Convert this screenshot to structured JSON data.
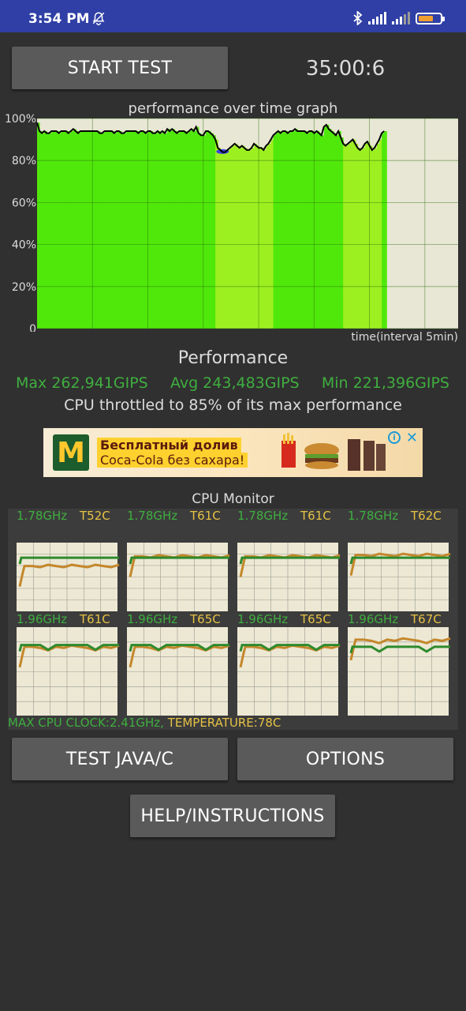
{
  "status": {
    "time": "3:54 PM",
    "battery_level": 0.7,
    "icons": [
      "bell-off-icon",
      "bluetooth-icon",
      "signal-icon",
      "signal-icon",
      "battery-icon"
    ]
  },
  "controls": {
    "start_label": "START TEST",
    "timer": "35:00:6"
  },
  "graph": {
    "title": "performance over time graph",
    "y_ticks": [
      "100%",
      "80%",
      "60%",
      "40%",
      "20%",
      "0"
    ],
    "time_label": "time(interval 5min)"
  },
  "chart_data": {
    "type": "area",
    "title": "performance over time graph",
    "xlabel": "time(interval 5min)",
    "ylabel": "",
    "ylim": [
      0,
      100
    ],
    "y_ticks": [
      "100%",
      "80%",
      "60%",
      "40%",
      "20%",
      "0"
    ],
    "elapsed_fraction": 0.83,
    "series": [
      {
        "values": [
          98,
          94,
          93,
          94,
          93,
          93,
          94,
          94,
          94,
          93,
          94,
          94,
          94,
          93,
          94,
          95,
          94,
          93,
          94,
          94,
          94,
          94,
          94,
          94,
          94,
          94,
          93,
          93,
          94,
          94,
          94,
          94,
          93,
          94,
          94,
          93,
          93,
          94,
          94,
          94,
          94,
          94,
          93,
          94,
          94,
          93,
          94,
          94,
          93,
          93,
          94,
          93,
          94,
          93,
          95,
          94,
          95,
          94,
          93,
          94,
          94,
          94,
          93,
          94,
          95,
          94,
          96,
          93,
          92,
          92,
          94,
          94,
          93,
          92,
          90,
          86,
          85,
          84,
          84,
          85,
          86,
          87,
          88,
          87,
          86,
          87,
          86,
          85,
          85,
          86,
          88,
          87,
          86,
          86,
          85,
          87,
          88,
          90,
          92,
          93,
          94,
          93,
          94,
          94,
          93,
          94,
          94,
          95,
          94,
          94,
          94,
          94,
          93,
          94,
          94,
          93,
          94,
          93,
          92,
          96,
          97,
          95,
          94,
          93,
          92,
          94,
          91,
          88,
          87,
          88,
          89,
          90,
          88,
          86,
          85,
          86,
          88,
          89,
          87,
          85,
          86,
          88,
          90,
          93,
          94
        ]
      }
    ],
    "colors": {
      "line": "#000000",
      "fill_high": "#50e80a",
      "fill_low": "#9df020",
      "dip_fill": "#3a44e0"
    }
  },
  "performance": {
    "title": "Performance",
    "max": "Max 262,941GIPS",
    "avg": "Avg 243,483GIPS",
    "min": "Min 221,396GIPS",
    "throttle_text": "CPU throttled to 85% of its max performance"
  },
  "ad": {
    "line1": "Бесплатный долив",
    "line2": "Coca-Cola без сахара!",
    "logo_icon": "mcdonalds-logo-icon"
  },
  "cpu_monitor": {
    "title": "CPU Monitor",
    "cores": [
      {
        "freq": "1.78GHz",
        "temp": "T52C",
        "freq_level": 0.78,
        "temp_level": 0.66
      },
      {
        "freq": "1.78GHz",
        "temp": "T61C",
        "freq_level": 0.78,
        "temp_level": 0.8
      },
      {
        "freq": "1.78GHz",
        "temp": "T61C",
        "freq_level": 0.78,
        "temp_level": 0.8
      },
      {
        "freq": "1.78GHz",
        "temp": "T62C",
        "freq_level": 0.78,
        "temp_level": 0.82
      },
      {
        "freq": "1.96GHz",
        "temp": "T61C",
        "freq_level": 0.8,
        "temp_level": 0.78
      },
      {
        "freq": "1.96GHz",
        "temp": "T65C",
        "freq_level": 0.8,
        "temp_level": 0.78
      },
      {
        "freq": "1.96GHz",
        "temp": "T65C",
        "freq_level": 0.8,
        "temp_level": 0.78
      },
      {
        "freq": "1.96GHz",
        "temp": "T67C",
        "freq_level": 0.78,
        "temp_level": 0.86
      }
    ],
    "footer_clock": "MAX CPU CLOCK:2.41GHz, ",
    "footer_temp": "TEMPERATURE:78C",
    "colors": {
      "freq": "#2d8a2d",
      "temp": "#c4872a",
      "panel_bg": "#ece8d4"
    }
  },
  "buttons": {
    "test_java": "TEST JAVA/C",
    "options": "OPTIONS",
    "help": "HELP/INSTRUCTIONS"
  }
}
